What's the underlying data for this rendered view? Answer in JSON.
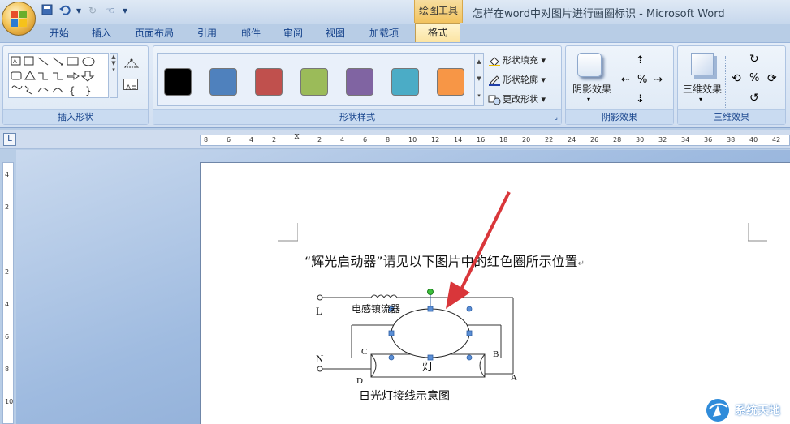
{
  "window": {
    "title": "怎样在word中对图片进行画圈标识 - Microsoft Word",
    "context_tab_title": "绘图工具"
  },
  "tabs": [
    "开始",
    "插入",
    "页面布局",
    "引用",
    "邮件",
    "审阅",
    "视图",
    "加载项",
    "格式"
  ],
  "active_tab": "格式",
  "ribbon": {
    "groups": {
      "insert_shapes": "插入形状",
      "shape_styles": "形状样式",
      "shadow_effects": "阴影效果",
      "three_d_effects": "三维效果"
    },
    "shape_fill": "形状填充",
    "shape_outline": "形状轮廓",
    "change_shape": "更改形状",
    "shadow_button": "阴影效果",
    "three_d_button": "三维效果",
    "swatch_colors": [
      "#000000",
      "#4f81bd",
      "#c0504d",
      "#9bbb59",
      "#8064a2",
      "#4bacc6",
      "#f79646"
    ]
  },
  "ruler": {
    "ticks": [
      "8",
      "6",
      "4",
      "2",
      "",
      "2",
      "4",
      "6",
      "8",
      "10",
      "12",
      "14",
      "16",
      "18",
      "20",
      "22",
      "24",
      "26",
      "28",
      "30",
      "32",
      "34",
      "36",
      "38",
      "40",
      "42"
    ],
    "vticks": [
      "4",
      "2",
      "",
      "2",
      "4",
      "6",
      "8",
      "10"
    ]
  },
  "document": {
    "paragraph": "“辉光启动器”请见以下图片中的红色圈所示位置",
    "diagram": {
      "label_L": "L",
      "label_N": "N",
      "inductor": "电感镇流器",
      "label_C": "C",
      "label_B": "B",
      "label_D": "D",
      "label_A": "A",
      "lamp": "灯",
      "caption": "日光灯接线示意图"
    }
  },
  "watermark": "系统天地"
}
